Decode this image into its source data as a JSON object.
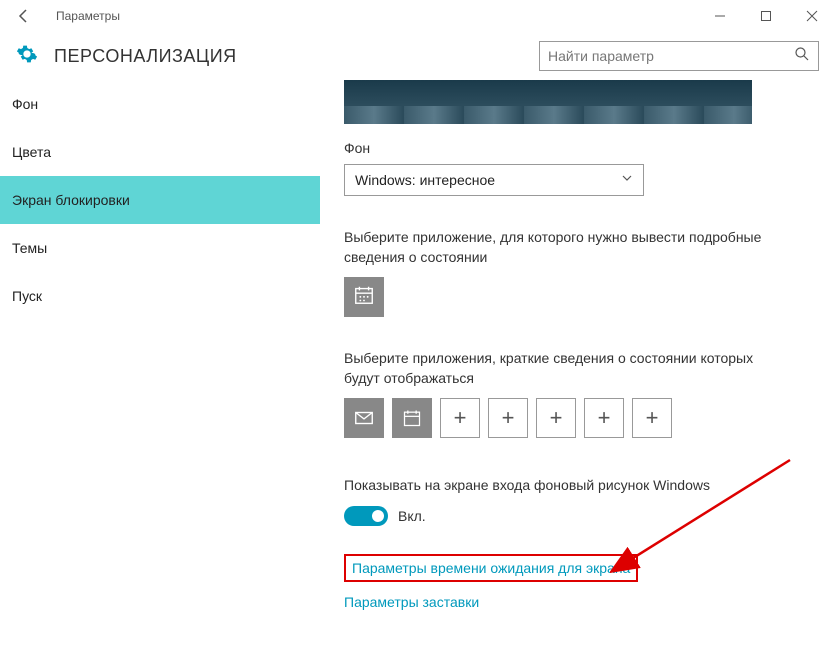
{
  "titlebar": {
    "title": "Параметры"
  },
  "header": {
    "page_title": "ПЕРСОНАЛИЗАЦИЯ",
    "search_placeholder": "Найти параметр"
  },
  "sidebar": {
    "items": [
      {
        "label": "Фон"
      },
      {
        "label": "Цвета"
      },
      {
        "label": "Экран блокировки",
        "selected": true
      },
      {
        "label": "Темы"
      },
      {
        "label": "Пуск"
      }
    ]
  },
  "content": {
    "background_label": "Фон",
    "background_dropdown": "Windows: интересное",
    "detailed_app_text": "Выберите приложение, для которого нужно вывести подробные сведения о состоянии",
    "quick_apps_text": "Выберите приложения, краткие сведения о состоянии которых будут отображаться",
    "signin_bg_label": "Показывать на экране входа фоновый рисунок Windows",
    "toggle_state": "Вкл.",
    "link_timeout": "Параметры времени ожидания для экрана",
    "link_screensaver": "Параметры заставки"
  }
}
